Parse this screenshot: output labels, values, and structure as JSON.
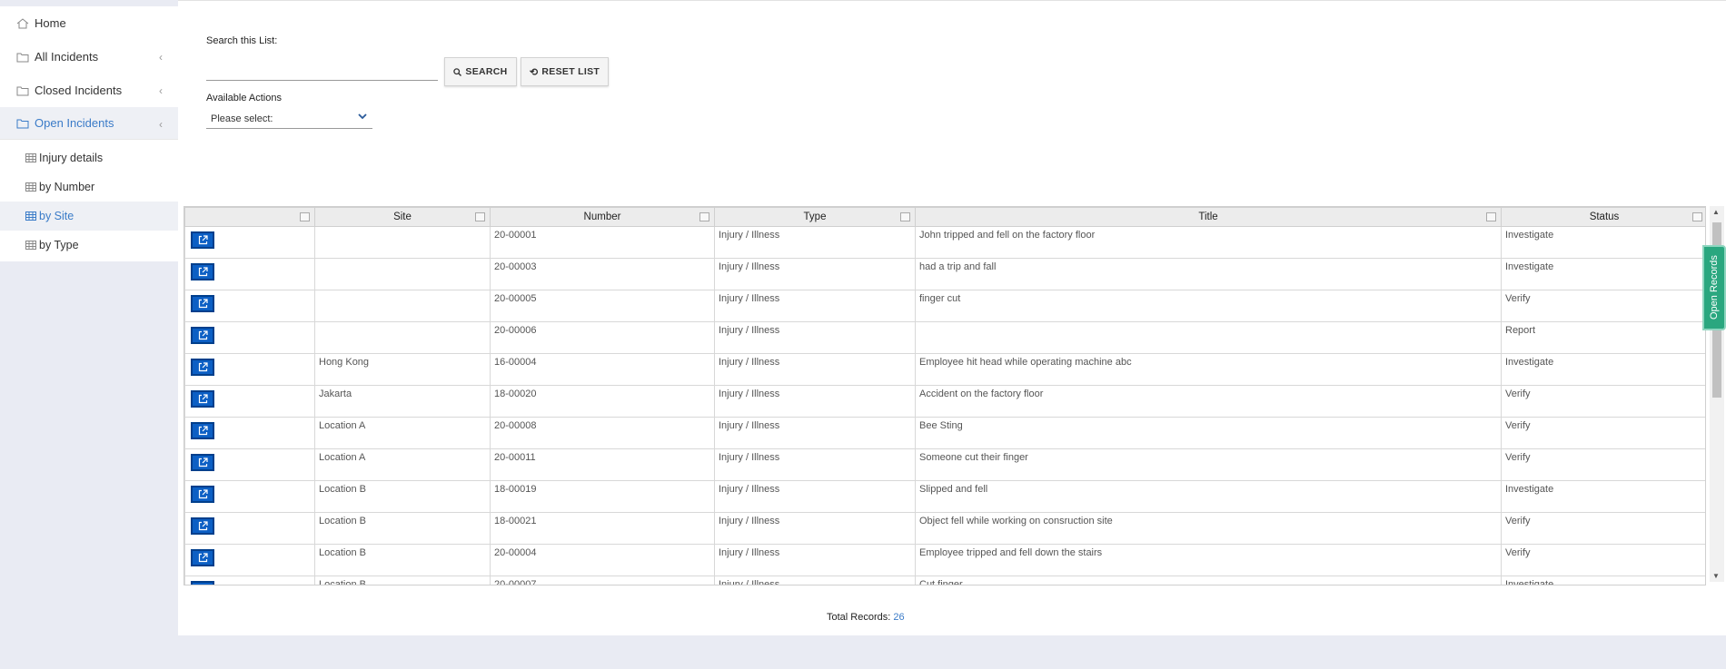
{
  "sidebar": {
    "top_items": [
      {
        "label": "Home",
        "icon": "home-icon"
      },
      {
        "label": "All Incidents",
        "icon": "folder-icon"
      },
      {
        "label": "Closed Incidents",
        "icon": "folder-icon"
      },
      {
        "label": "Open Incidents",
        "icon": "folder-icon"
      }
    ],
    "sub_items": [
      {
        "label": "Injury details"
      },
      {
        "label": "by Number"
      },
      {
        "label": "by Site"
      },
      {
        "label": "by Type"
      }
    ]
  },
  "search": {
    "label": "Search this List:",
    "value": "",
    "search_button": "SEARCH",
    "reset_button": "RESET LIST"
  },
  "actions": {
    "label": "Available Actions",
    "selected": "Please select:"
  },
  "grid": {
    "columns": [
      "",
      "Site",
      "Number",
      "Type",
      "Title",
      "Status"
    ],
    "rows": [
      {
        "site": "",
        "number": "20-00001",
        "type": "Injury / Illness",
        "title": "John tripped and fell on the factory floor",
        "status": "Investigate"
      },
      {
        "site": "",
        "number": "20-00003",
        "type": "Injury / Illness",
        "title": "had a trip and fall",
        "status": "Investigate"
      },
      {
        "site": "",
        "number": "20-00005",
        "type": "Injury / Illness",
        "title": "finger cut",
        "status": "Verify"
      },
      {
        "site": "",
        "number": "20-00006",
        "type": "Injury / Illness",
        "title": "",
        "status": "Report"
      },
      {
        "site": "Hong Kong",
        "number": "16-00004",
        "type": "Injury / Illness",
        "title": "Employee hit head while operating machine abc",
        "status": "Investigate"
      },
      {
        "site": "Jakarta",
        "number": "18-00020",
        "type": "Injury / Illness",
        "title": "Accident on the factory floor",
        "status": "Verify"
      },
      {
        "site": "Location A",
        "number": "20-00008",
        "type": "Injury / Illness",
        "title": "Bee Sting",
        "status": "Verify"
      },
      {
        "site": "Location A",
        "number": "20-00011",
        "type": "Injury / Illness",
        "title": "Someone cut their finger",
        "status": "Verify"
      },
      {
        "site": "Location B",
        "number": "18-00019",
        "type": "Injury / Illness",
        "title": "Slipped and fell",
        "status": "Investigate"
      },
      {
        "site": "Location B",
        "number": "18-00021",
        "type": "Injury / Illness",
        "title": "Object fell while working on consruction site",
        "status": "Verify"
      },
      {
        "site": "Location B",
        "number": "20-00004",
        "type": "Injury / Illness",
        "title": "Employee tripped and fell down the stairs",
        "status": "Verify"
      },
      {
        "site": "Location B",
        "number": "20-00007",
        "type": "Injury / Illness",
        "title": "Cut finger",
        "status": "Investigate"
      }
    ]
  },
  "footer": {
    "total_label": "Total Records:",
    "total_value": "26"
  },
  "side_tab": {
    "label": "Open Records"
  },
  "colors": {
    "accent": "#3a7bc8",
    "open_button": "#0c5fc4",
    "side_tab": "#2aa77f"
  }
}
